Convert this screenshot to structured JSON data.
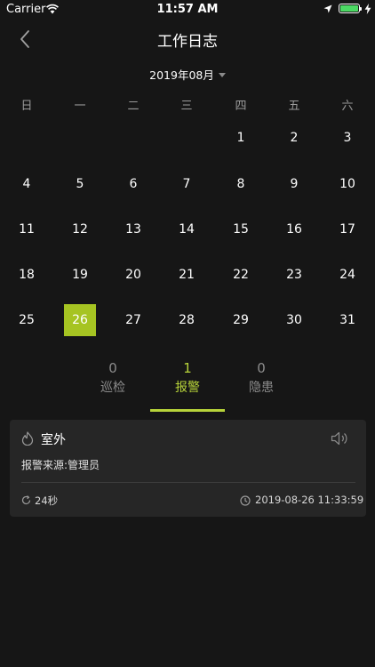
{
  "status_bar": {
    "carrier": "Carrier",
    "time": "11:57 AM",
    "battery_color": "#4cd964"
  },
  "nav": {
    "title": "工作日志",
    "back_icon": "chevron-left-icon"
  },
  "calendar": {
    "month_label": "2019年08月",
    "weekdays": [
      "日",
      "一",
      "二",
      "三",
      "四",
      "五",
      "六"
    ],
    "weeks": [
      [
        "",
        "",
        "",
        "",
        "1",
        "2",
        "3"
      ],
      [
        "4",
        "5",
        "6",
        "7",
        "8",
        "9",
        "10"
      ],
      [
        "11",
        "12",
        "13",
        "14",
        "15",
        "16",
        "17"
      ],
      [
        "18",
        "19",
        "20",
        "21",
        "22",
        "23",
        "24"
      ],
      [
        "25",
        "26",
        "27",
        "28",
        "29",
        "30",
        "31"
      ]
    ],
    "selected_day": "26",
    "selected_color": "#a6c422"
  },
  "tabs": [
    {
      "count": "0",
      "label": "巡检",
      "active": false
    },
    {
      "count": "1",
      "label": "报警",
      "active": true
    },
    {
      "count": "0",
      "label": "隐患",
      "active": false
    }
  ],
  "accent_color": "#b7d33a",
  "record": {
    "icon": "fire-icon",
    "title": "室外",
    "source": "报警来源:管理员",
    "duration": "24秒",
    "timestamp": "2019-08-26 11:33:59",
    "speaker_icon": "speaker-icon"
  }
}
